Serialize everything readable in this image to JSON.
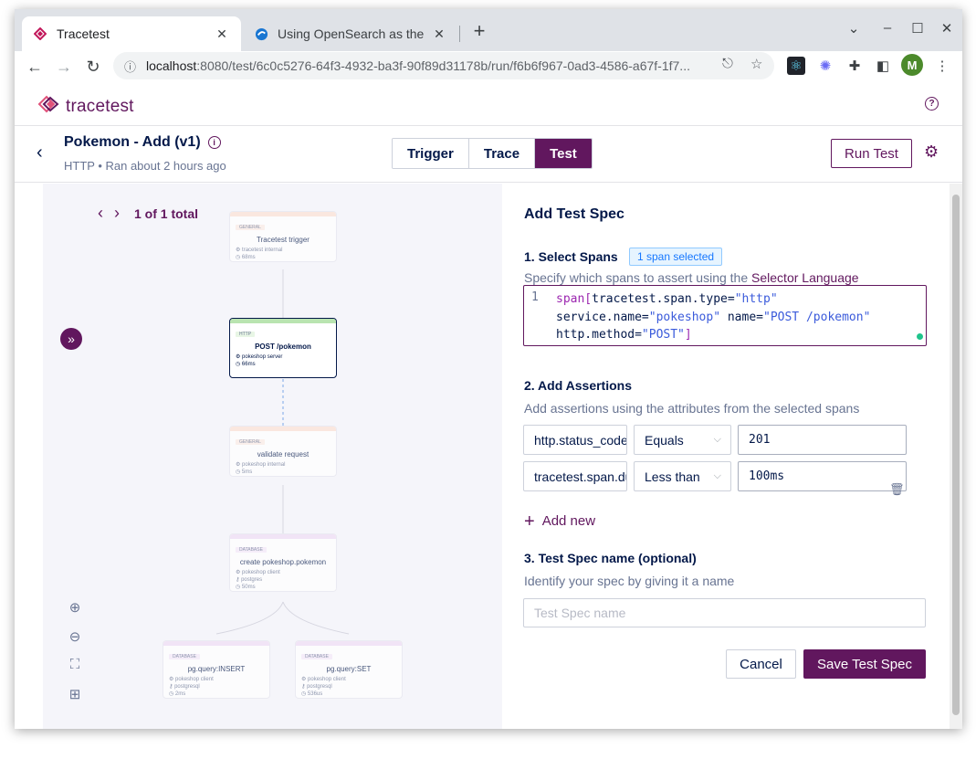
{
  "browser": {
    "tabs": [
      {
        "title": "Tracetest",
        "active": true
      },
      {
        "title": "Using OpenSearch as the",
        "active": false
      }
    ],
    "url_host": "localhost",
    "url_rest": ":8080/test/6c0c5276-64f3-4932-ba3f-90f89d31178b/run/f6b6f967-0ad3-4586-a67f-1f7...",
    "avatar_letter": "M",
    "colors": {
      "chrome_bg": "#dfe2e7",
      "avatar": "#4c8a2b"
    }
  },
  "app": {
    "logo_text": "tracetest",
    "help_glyph": "?",
    "brand_color": "#61175e",
    "test": {
      "title": "Pokemon - Add (v1)",
      "subtitle": "HTTP • Ran about 2 hours ago"
    },
    "tabs": [
      {
        "label": "Trigger",
        "active": false
      },
      {
        "label": "Trace",
        "active": false
      },
      {
        "label": "Test",
        "active": true
      }
    ],
    "run_button": "Run Test"
  },
  "diagram": {
    "pager_text": "1 of 1 total",
    "nodes": [
      {
        "badge": "GENERAL",
        "name": "Tracetest trigger",
        "service": "tracetest internal",
        "duration": "68ms",
        "selected": false
      },
      {
        "badge": "HTTP",
        "name": "POST /pokemon",
        "service": "pokeshop server",
        "duration": "66ms",
        "selected": true
      },
      {
        "badge": "GENERAL",
        "name": "validate request",
        "service": "pokeshop internal",
        "duration": "5ms",
        "selected": false
      },
      {
        "badge": "DATABASE",
        "name": "create pokeshop.pokemon",
        "service": "pokeshop client",
        "db": "postgres",
        "duration": "50ms",
        "selected": false
      },
      {
        "badge": "DATABASE",
        "name": "pg.query:INSERT",
        "service": "pokeshop client",
        "db": "postgresql",
        "duration": "2ms",
        "selected": false
      },
      {
        "badge": "DATABASE",
        "name": "pg.query:SET",
        "service": "pokeshop client",
        "db": "postgresql",
        "duration": "536us",
        "selected": false
      }
    ]
  },
  "spec": {
    "heading": "Add Test Spec",
    "select_spans": {
      "title": "1. Select Spans",
      "tag": "1 span selected",
      "desc_prefix": "Specify which spans to assert using the ",
      "desc_link": "Selector Language",
      "line_number": "1"
    },
    "assertions": {
      "title": "2. Add Assertions",
      "desc": "Add assertions using the attributes from the selected spans",
      "rows": [
        {
          "attribute": "http.status_code",
          "operator": "Equals",
          "value": "201"
        },
        {
          "attribute": "tracetest.span.duration",
          "operator": "Less than",
          "value": "100ms"
        }
      ],
      "add_new": "Add new"
    },
    "name_section": {
      "title": "3. Test Spec name (optional)",
      "desc": "Identify your spec by giving it a name",
      "placeholder": "Test Spec name"
    },
    "cancel": "Cancel",
    "save": "Save Test Spec"
  }
}
